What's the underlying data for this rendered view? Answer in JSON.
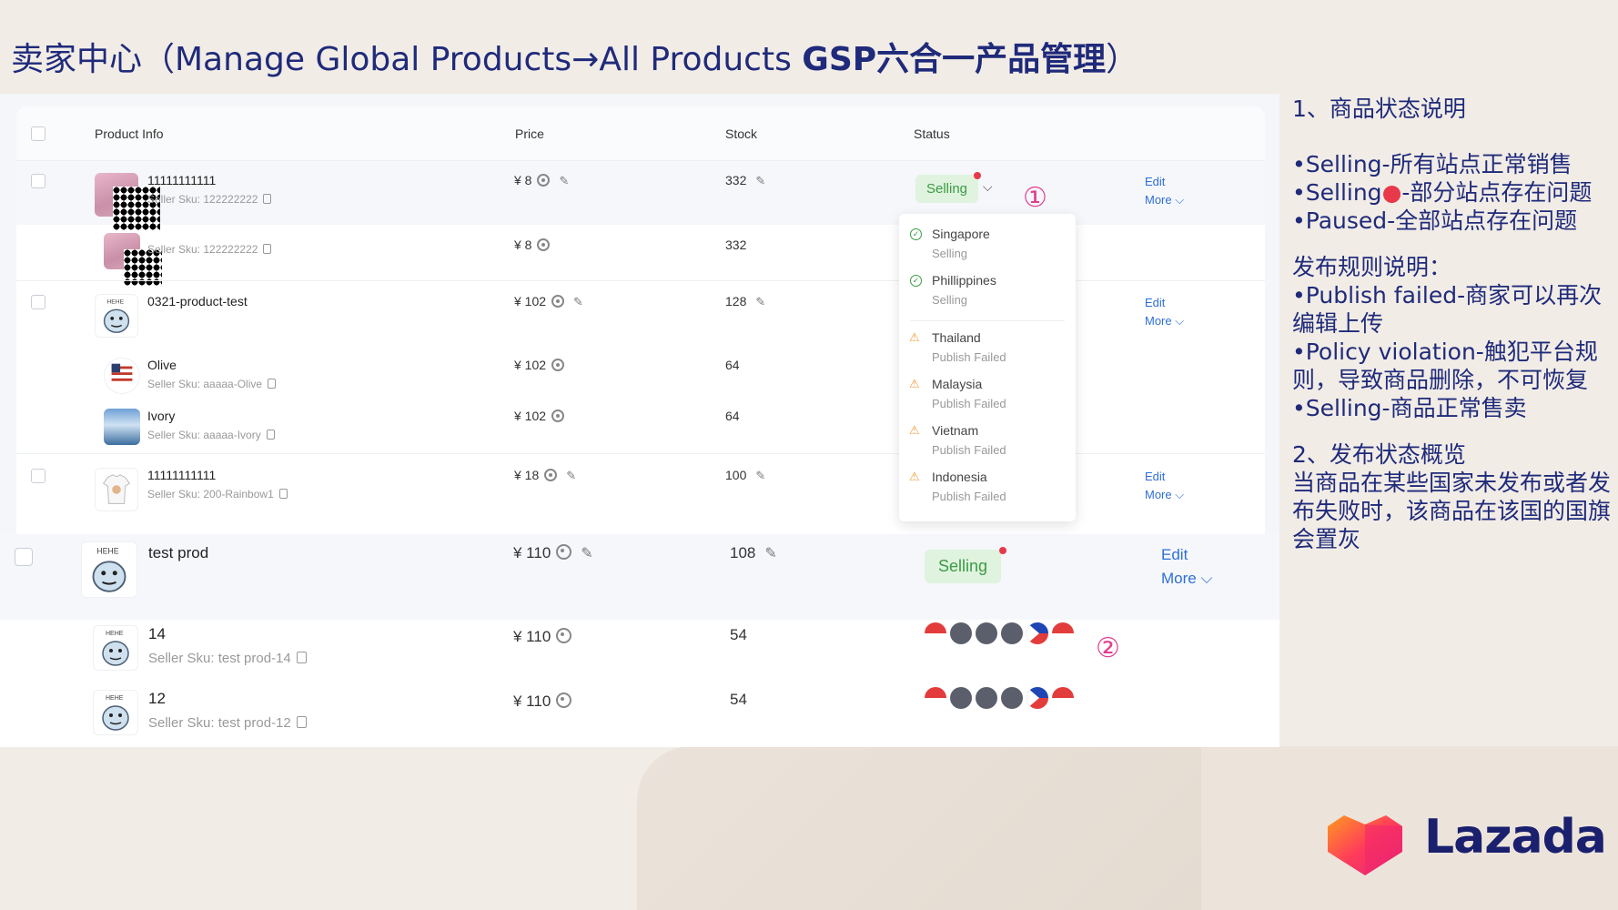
{
  "slide": {
    "title_prefix": "卖家中心（Manage Global Products→All Products ",
    "title_bold": "GSP六合一产品管理",
    "title_suffix": "）"
  },
  "table": {
    "headers": {
      "product_info": "Product Info",
      "price": "Price",
      "stock": "Stock",
      "status": "Status"
    },
    "rows": [
      {
        "name": "11111111111",
        "sku": "Seller Sku: 122222222",
        "price": "¥ 8",
        "stock": "332",
        "status": "Selling",
        "edit": "Edit",
        "more": "More"
      },
      {
        "sku": "Seller Sku: 122222222",
        "price": "¥ 8",
        "stock": "332"
      },
      {
        "name": "0321-product-test",
        "price": "¥ 102",
        "stock": "128",
        "edit": "Edit",
        "more": "More"
      },
      {
        "name": "Olive",
        "sku": "Seller Sku: aaaaa-Olive",
        "price": "¥ 102",
        "stock": "64"
      },
      {
        "name": "Ivory",
        "sku": "Seller Sku: aaaaa-Ivory",
        "price": "¥ 102",
        "stock": "64"
      },
      {
        "name": "11111111111",
        "sku": "Seller Sku: 200-Rainbow1",
        "price": "¥ 18",
        "stock": "100",
        "edit": "Edit",
        "more": "More"
      },
      {
        "name": "test prod",
        "price": "¥ 110",
        "stock": "108",
        "status": "Selling",
        "edit": "Edit",
        "more": "More"
      },
      {
        "name": "14",
        "sku": "Seller Sku: test prod-14",
        "price": "¥ 110",
        "stock": "54",
        "flags": [
          "sg",
          "grey",
          "grey",
          "grey",
          "ph",
          "id"
        ]
      },
      {
        "name": "12",
        "sku": "Seller Sku: test prod-12",
        "price": "¥ 110",
        "stock": "54",
        "flags": [
          "sg",
          "grey",
          "grey",
          "grey",
          "ph",
          "id"
        ]
      }
    ]
  },
  "status_dropdown": {
    "items": [
      {
        "country": "Singapore",
        "status": "Selling",
        "icon": "check-circle-icon"
      },
      {
        "country": "Phillippines",
        "status": "Selling",
        "icon": "check-circle-icon"
      },
      {
        "country": "Thailand",
        "status": "Publish Failed",
        "icon": "warning-icon"
      },
      {
        "country": "Malaysia",
        "status": "Publish Failed",
        "icon": "warning-icon"
      },
      {
        "country": "Vietnam",
        "status": "Publish Failed",
        "icon": "warning-icon"
      },
      {
        "country": "Indonesia",
        "status": "Publish Failed",
        "icon": "warning-icon"
      }
    ]
  },
  "callouts": {
    "one": "①",
    "two": "②"
  },
  "notes": {
    "heading1": "1、商品状态说明",
    "s1": "•Selling-所有站点正常销售",
    "s2_a": "•Selling",
    "s2_dot": "●",
    "s2_b": "-部分站点存在问题",
    "s3": "•Paused-全部站点存在问题",
    "heading_rules": "发布规则说明：",
    "r1": "•Publish failed-商家可以再次编辑上传",
    "r2": "•Policy violation-触犯平台规则，导致商品删除，不可恢复",
    "r3": "•Selling-商品正常售卖",
    "heading2": "2、发布状态概览",
    "p2": "当商品在某些国家未发布或者发布失败时，该商品在该国的国旗会置灰"
  },
  "logo": {
    "text": "Lazada"
  },
  "colors": {
    "title": "#1f2a7a",
    "selling_green": "#3d9a44",
    "selling_bg": "#dff3df",
    "link_blue": "#2f6fd6",
    "callout_pink": "#e23c8e",
    "warn_orange": "#f09b3a",
    "dot_red": "#e8394a"
  }
}
